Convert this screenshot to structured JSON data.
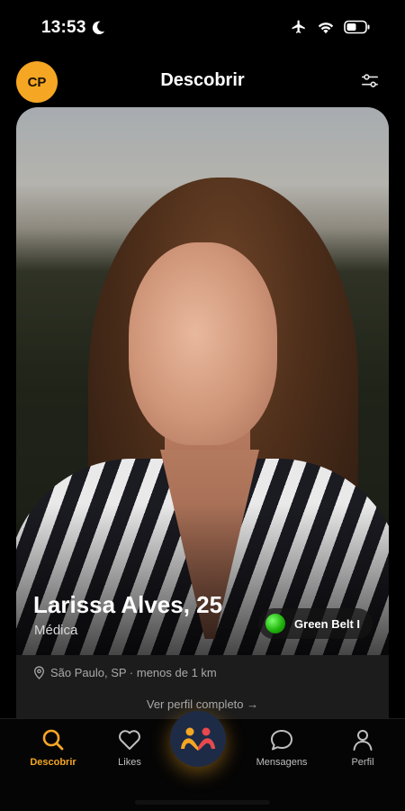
{
  "status_bar": {
    "time": "13:53",
    "icons": [
      "moon-icon",
      "airplane-icon",
      "wifi-icon",
      "battery-icon"
    ]
  },
  "header": {
    "avatar_initials": "CP",
    "title": "Descobrir",
    "filter_icon": "sliders-icon"
  },
  "profile": {
    "name_age": "Larissa Alves, 25",
    "occupation": "Médica",
    "belt_label": "Green Belt I",
    "location": "São Paulo, SP · menos de 1 km",
    "view_full_profile": "Ver perfil completo →"
  },
  "nav": {
    "items": [
      {
        "label": "Descobrir",
        "icon": "search-icon",
        "active": true
      },
      {
        "label": "Likes",
        "icon": "heart-icon",
        "active": false
      },
      {
        "label": "",
        "icon": "match-people-icon",
        "active": false
      },
      {
        "label": "Mensagens",
        "icon": "chat-bubble-icon",
        "active": false
      },
      {
        "label": "Perfil",
        "icon": "person-icon",
        "active": false
      }
    ]
  },
  "colors": {
    "accent": "#f5a623",
    "background": "#000000",
    "belt_green": "#20b40c",
    "center_button": "#1d2b47"
  }
}
